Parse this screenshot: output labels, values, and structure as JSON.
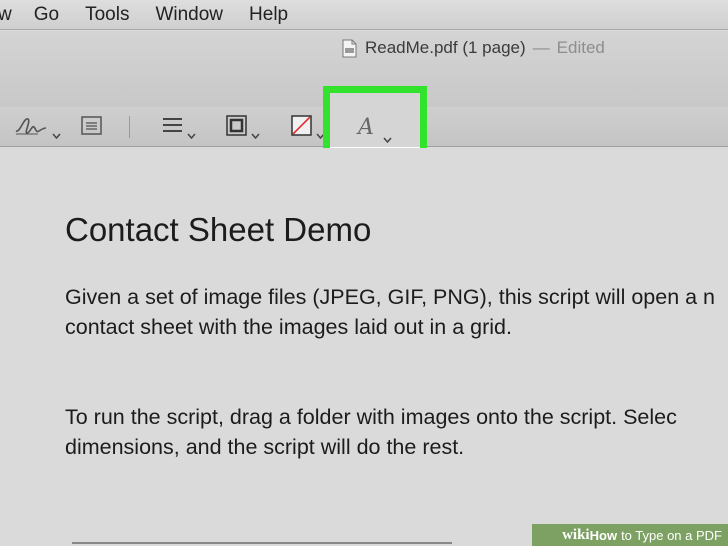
{
  "menubar": {
    "items": [
      "w",
      "Go",
      "Tools",
      "Window",
      "Help"
    ]
  },
  "window": {
    "title": "ReadMe.pdf (1 page)",
    "separator": "—",
    "status": "Edited",
    "doc_icon": "pdf-document-icon"
  },
  "toolbar": {
    "tools": [
      {
        "name": "sign-tool",
        "icon": "signature-icon"
      },
      {
        "name": "note-tool",
        "icon": "note-icon"
      },
      {
        "name": "shape-style-tool",
        "icon": "line-style-icon"
      },
      {
        "name": "border-color-tool",
        "icon": "border-color-icon"
      },
      {
        "name": "fill-color-tool",
        "icon": "fill-color-icon"
      },
      {
        "name": "text-style-tool",
        "icon": "font-icon",
        "glyph": "A"
      }
    ]
  },
  "document": {
    "title": "Contact Sheet Demo",
    "paragraph1": [
      "Given a set of image files (JPEG, GIF, PNG), this script will open a n",
      "contact sheet with the images laid out in a grid."
    ],
    "paragraph2": [
      "To run the script, drag a folder with images onto the script.  Selec",
      "dimensions, and the script will do the rest."
    ]
  },
  "watermark": {
    "wiki": "wiki",
    "how": "How",
    "text": "to Type on a PDF"
  },
  "colors": {
    "highlight": "#32e22c",
    "menubar": "#d6d6d6",
    "document_bg": "#dadada",
    "watermark": "#6c964e"
  }
}
